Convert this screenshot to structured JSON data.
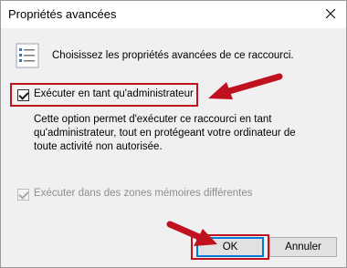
{
  "window": {
    "title": "Propriétés avancées"
  },
  "header": {
    "text": "Choisissez les propriétés avancées de ce raccourci."
  },
  "run_as_admin": {
    "label": "Exécuter en tant qu'administrateur",
    "checked": true
  },
  "description": "Cette option permet d'exécuter ce raccourci en tant\nqu'administrateur, tout en protégeant votre ordinateur de\ntoute activité non autorisée.",
  "separate_memory": {
    "label": "Exécuter dans des zones mémoires différentes",
    "checked": true,
    "enabled": false
  },
  "buttons": {
    "ok": "OK",
    "cancel": "Annuler"
  },
  "colors": {
    "highlight": "#c0111f",
    "default_button_border": "#0078d7"
  }
}
